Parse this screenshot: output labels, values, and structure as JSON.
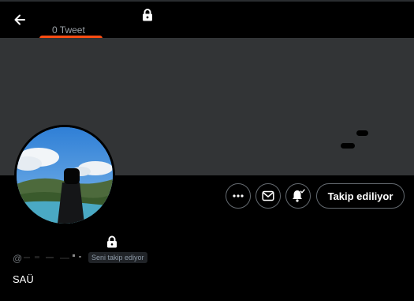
{
  "header": {
    "tweet_count": "0 Tweet",
    "back_icon": "arrow-left-icon",
    "lock_icon": "lock-icon"
  },
  "banner": {
    "color": "#323436"
  },
  "actions": {
    "more_icon": "more-horizontal-icon",
    "message_icon": "envelope-icon",
    "notify_icon": "bell-check-icon",
    "follow_label": "Takip ediliyor"
  },
  "profile": {
    "handle_prefix": "@",
    "follows_you": "Seni takip ediyor",
    "bio": "SAÜ",
    "lock_icon": "lock-icon"
  },
  "colors": {
    "background": "#000000",
    "redaction": "#ff4d12",
    "border": "#646a70"
  }
}
